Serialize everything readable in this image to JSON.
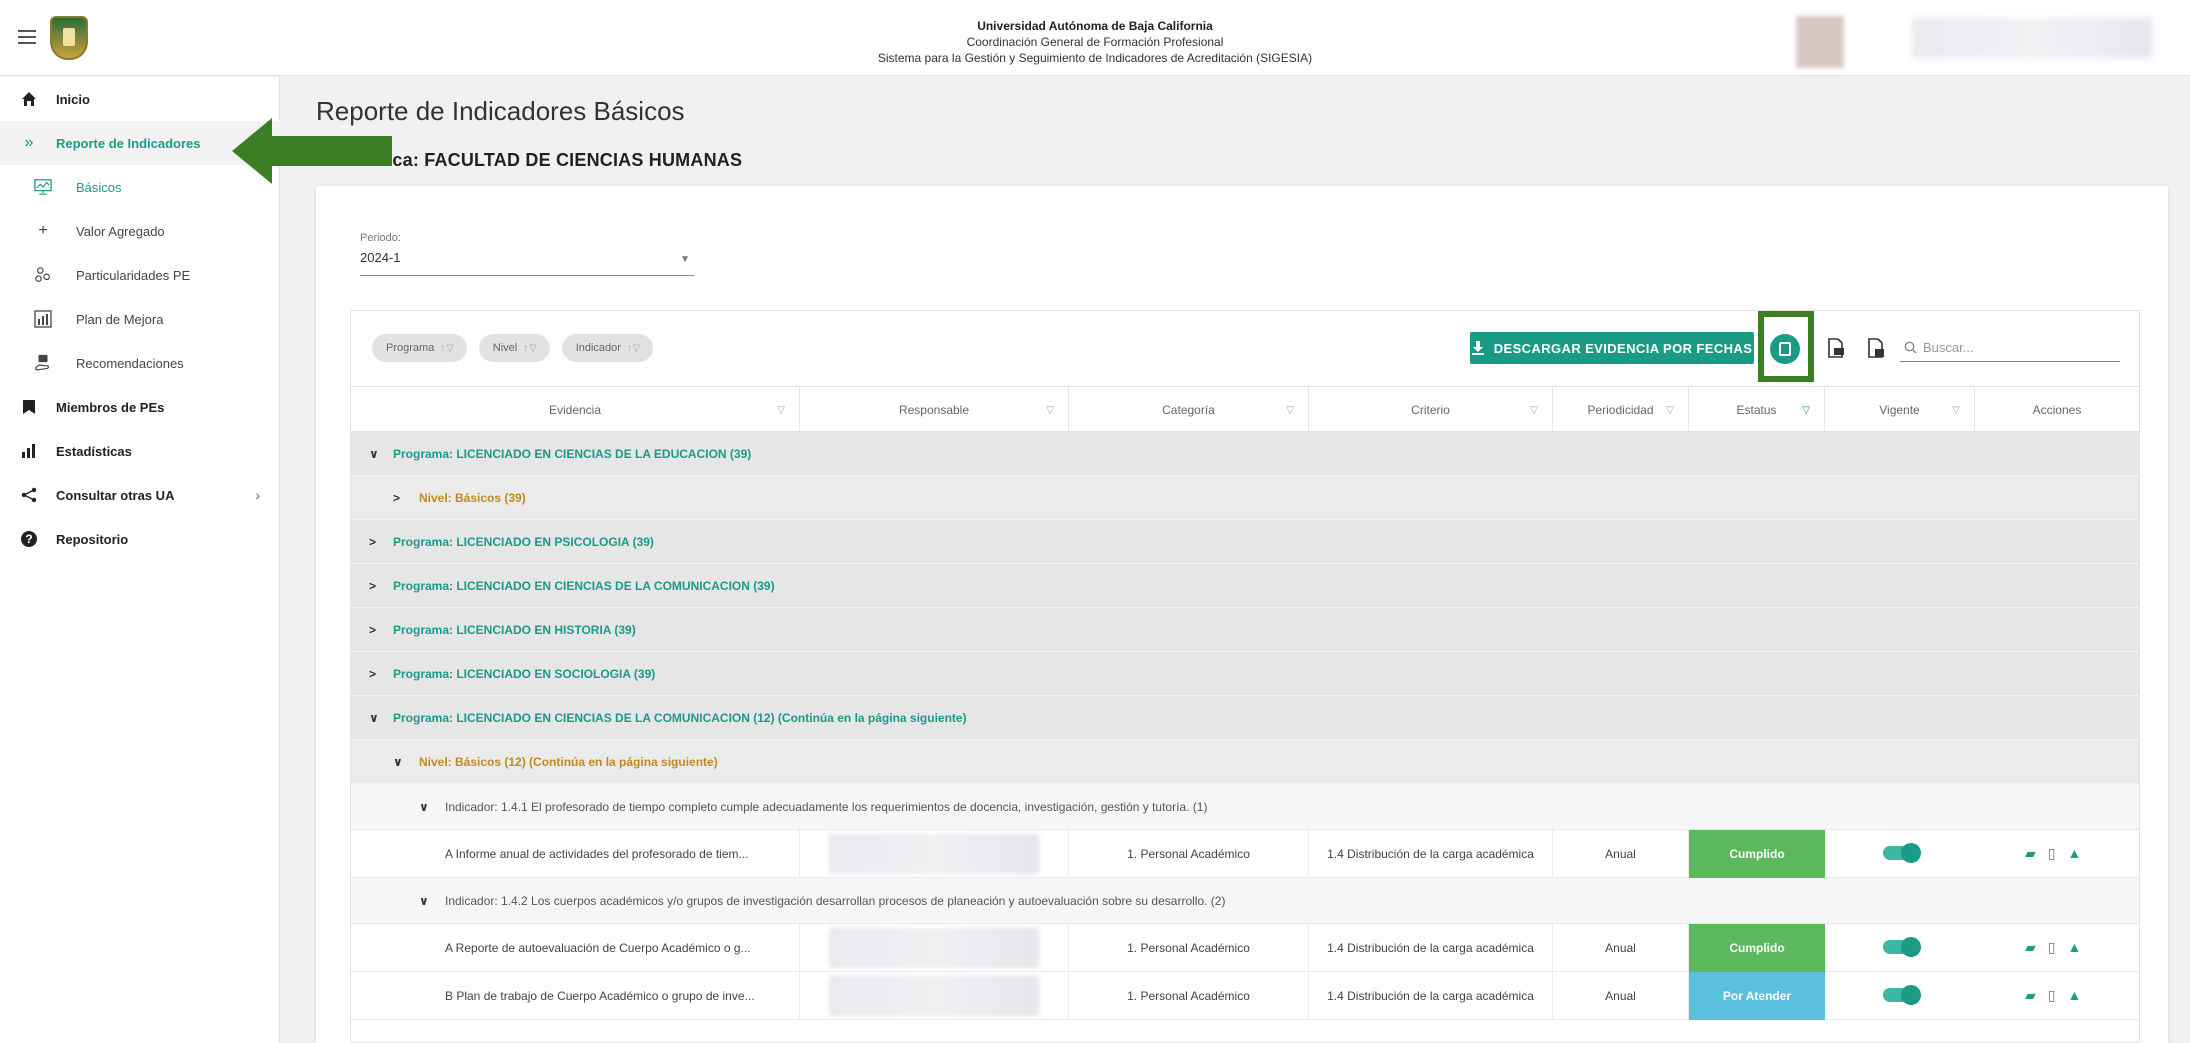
{
  "header": {
    "line1": "Universidad Autónoma de Baja California",
    "line2": "Coordinación General de Formación Profesional",
    "line3": "Sistema para la Gestión y Seguimiento de Indicadores de Acreditación (SIGESIA)"
  },
  "sidebar": {
    "items": [
      {
        "label": "Inicio",
        "icon": "home-icon"
      },
      {
        "label": "Reporte de Indicadores",
        "icon": "double-chevron-icon"
      },
      {
        "label": "Básicos",
        "icon": "chart-monitor-icon"
      },
      {
        "label": "Valor Agregado",
        "icon": "plus-icon"
      },
      {
        "label": "Particularidades PE",
        "icon": "molecule-icon"
      },
      {
        "label": "Plan de Mejora",
        "icon": "bar-chart-icon"
      },
      {
        "label": "Recomendaciones",
        "icon": "hand-icon"
      },
      {
        "label": "Miembros de PEs",
        "icon": "bookmark-icon"
      },
      {
        "label": "Estadísticas",
        "icon": "stats-icon"
      },
      {
        "label": "Consultar otras UA",
        "icon": "share-icon"
      },
      {
        "label": "Repositorio",
        "icon": "help-icon"
      }
    ]
  },
  "main": {
    "title": "Reporte de Indicadores Básicos",
    "ua": "Académica: FACULTAD DE CIENCIAS HUMANAS",
    "period_label": "Periodo:",
    "period_value": "2024-1",
    "chips": [
      "Programa",
      "Nivel",
      "Indicador"
    ],
    "download_button": "DESCARGAR EVIDENCIA POR FECHAS",
    "search_placeholder": "Buscar..."
  },
  "table": {
    "columns": [
      "Evidencia",
      "Responsable",
      "Categoría",
      "Criterio",
      "Periodicidad",
      "Estatus",
      "Vigente",
      "Acciones"
    ],
    "groups": [
      "Programa: LICENCIADO EN CIENCIAS DE LA EDUCACION (39)",
      "Nivel: Básicos (39)",
      "Programa: LICENCIADO EN PSICOLOGIA (39)",
      "Programa: LICENCIADO EN CIENCIAS DE LA COMUNICACION (39)",
      "Programa: LICENCIADO EN HISTORIA (39)",
      "Programa: LICENCIADO EN SOCIOLOGIA (39)",
      "Programa: LICENCIADO EN CIENCIAS DE LA COMUNICACION (12) (Continúa en la página siguiente)",
      "Nivel: Básicos (12) (Continúa en la página siguiente)"
    ],
    "indicators": [
      "Indicador: 1.4.1 El profesorado de tiempo completo cumple adecuadamente los requerimientos de docencia, investigación, gestión y tutoría. (1)",
      "Indicador: 1.4.2 Los cuerpos académicos y/o grupos de investigación desarrollan procesos de planeación y autoevaluación sobre su desarrollo. (2)"
    ],
    "rows": [
      {
        "evidencia": "A Informe anual de actividades del profesorado de tiem...",
        "categoria": "1. Personal Académico",
        "criterio": "1.4 Distribución de la carga académica",
        "periodicidad": "Anual",
        "estatus": "Cumplido"
      },
      {
        "evidencia": "A Reporte de autoevaluación de Cuerpo Académico o g...",
        "categoria": "1. Personal Académico",
        "criterio": "1.4 Distribución de la carga académica",
        "periodicidad": "Anual",
        "estatus": "Cumplido"
      },
      {
        "evidencia": "B Plan de trabajo de Cuerpo Académico o grupo de inve...",
        "categoria": "1. Personal Académico",
        "criterio": "1.4 Distribución de la carga académica",
        "periodicidad": "Anual",
        "estatus": "Por Atender"
      }
    ]
  },
  "colors": {
    "accent": "#1a9b86",
    "cumplido": "#5cb85c",
    "por_atender": "#5bc0de",
    "nivel_text": "#c08a1e",
    "highlight": "#3c7e23"
  }
}
